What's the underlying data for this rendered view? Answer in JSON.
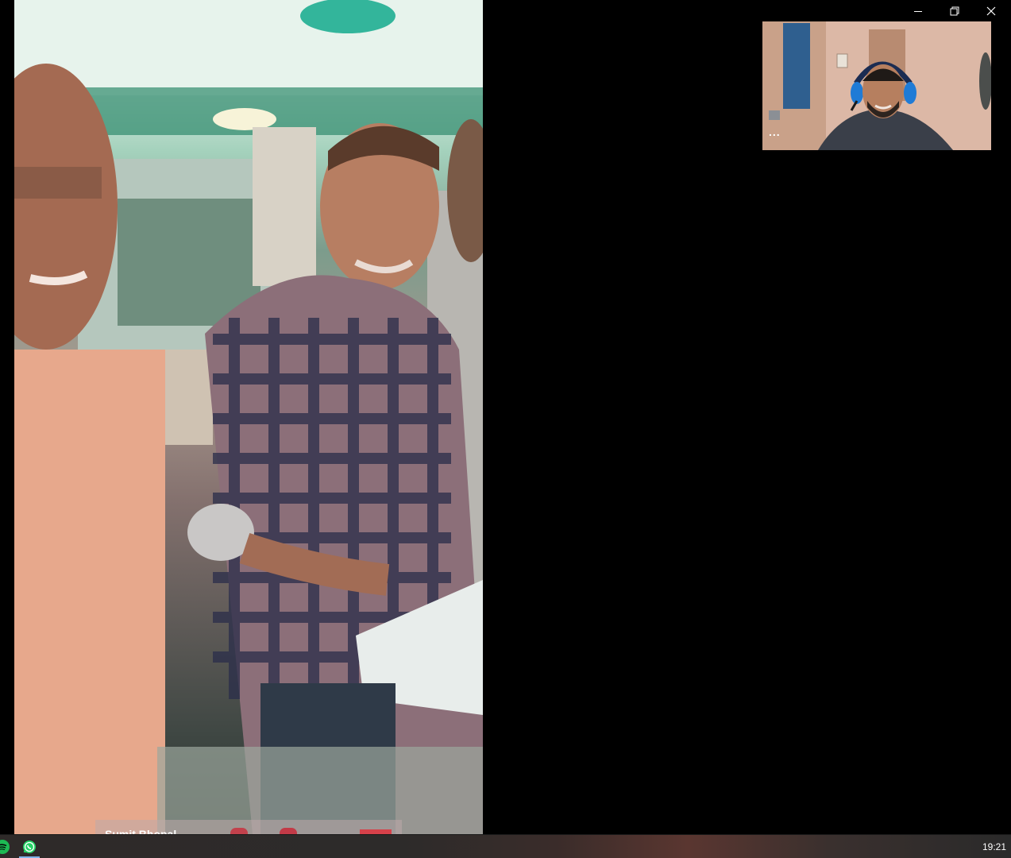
{
  "window": {
    "controls": {
      "minimize_icon": "minimize-icon",
      "restore_icon": "restore-icon",
      "close_icon": "close-icon"
    }
  },
  "call": {
    "remote": {
      "name": "Sumit Bhopal",
      "video_description": "remote-camera-feed"
    },
    "self_view": {
      "more_label": "..."
    }
  },
  "taskbar": {
    "apps": [
      {
        "name": "Spotify",
        "icon": "spotify-icon",
        "color": "#1db954"
      },
      {
        "name": "WhatsApp",
        "icon": "whatsapp-icon",
        "color": "#25d366",
        "active": true
      }
    ],
    "clock": "19:21"
  },
  "colors": {
    "background": "#000000",
    "taskbar_accent": "#7fb4ea"
  }
}
